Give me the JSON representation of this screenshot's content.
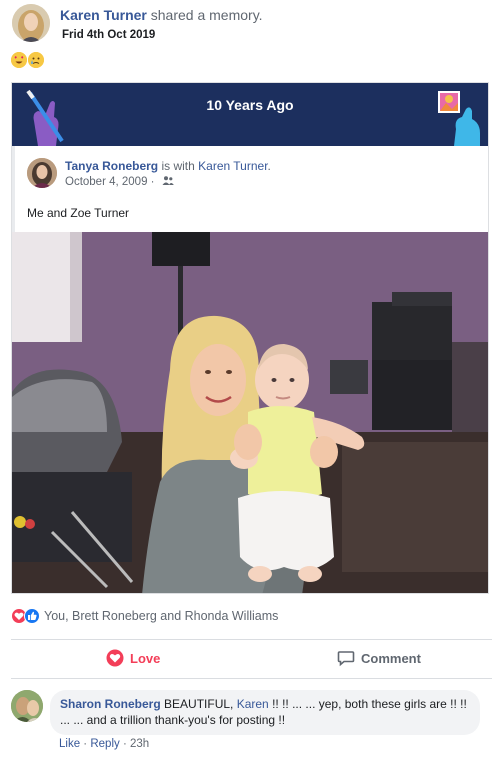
{
  "header": {
    "author_name": "Karen Turner",
    "action_text": " shared a memory.",
    "date": "Frid 4th Oct 2019",
    "emojis": [
      "heart-eyes-emoji",
      "crying-emoji"
    ]
  },
  "memory": {
    "banner_title": "10 Years Ago",
    "post": {
      "author_name": "Tanya Roneberg",
      "with_text": " is with ",
      "tagged_name": "Karen Turner",
      "tagged_suffix": ".",
      "date": "October 4, 2009 · ",
      "audience_icon": "friends-icon",
      "caption": "Me and Zoe Turner"
    }
  },
  "reactions": {
    "icons": [
      "love-reaction-icon",
      "like-reaction-icon"
    ],
    "names": "You, Brett Roneberg and Rhonda Williams"
  },
  "actions": {
    "love_label": "Love",
    "comment_label": "Comment"
  },
  "comment": {
    "author_name": "Sharon Roneberg",
    "text_before_mention": " BEAUTIFUL, ",
    "mention": "Karen",
    "text_after_mention": " !! !! ... ... yep, both these girls are !! !! ... ... and a trillion thank-you's for posting !!",
    "like_label": "Like",
    "reply_label": "Reply",
    "separator": " · ",
    "time": "23h"
  },
  "colors": {
    "link_blue": "#385898",
    "love_red": "#f33e58",
    "banner_navy": "#1c2f5e"
  }
}
